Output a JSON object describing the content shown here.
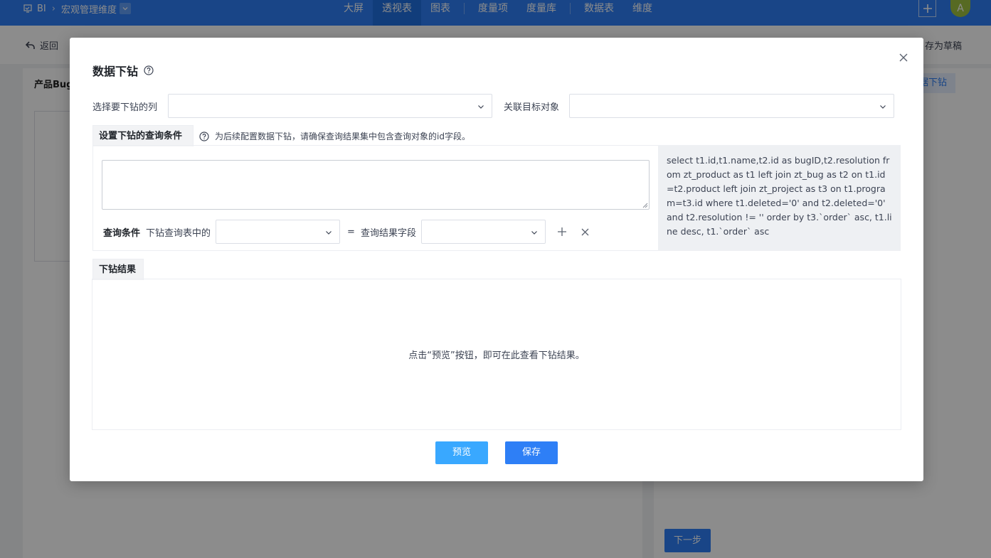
{
  "topbar": {
    "brand": "BI",
    "workspace": "宏观管理维度",
    "nav": [
      "大屏",
      "透视表",
      "图表",
      "度量项",
      "度量库",
      "数据表",
      "维度"
    ],
    "active_nav_index": 1,
    "avatar_letter": "A",
    "brand_color": "#2e7ff6"
  },
  "page": {
    "back_label": "返回",
    "draft_label": "存为草稿",
    "left_title": "产品Bug",
    "right_pill": "据下钻",
    "next_label": "下一步"
  },
  "modal": {
    "title": "数据下钻",
    "select_column_label": "选择要下钻的列",
    "select_column_value": "",
    "target_object_label": "关联目标对象",
    "target_object_value": "",
    "query_tab_label": "设置下钻的查询条件",
    "query_hint": "为后续配置数据下钻，请确保查询结果集中包含查询对象的id字段。",
    "query_sql_input": "",
    "condition_label": "查询条件",
    "drill_field_label": "下钻查询表中的",
    "drill_field_value": "",
    "equals": "=",
    "result_field_label": "查询结果字段",
    "result_field_value": "",
    "sql": "select t1.id,t1.name,t2.id as bugID,t2.resolution from zt_product as t1 left join zt_bug as t2 on t1.id=t2.product left join zt_project as t3 on t1.program=t3.id where t1.deleted='0' and t2.deleted='0' and t2.resolution != '' order by t3.`order` asc, t1.line desc, t1.`order` asc",
    "result_tab_label": "下钻结果",
    "result_empty": "点击“预览”按钮，即可在此查看下钻结果。",
    "preview_label": "预览",
    "save_label": "保存"
  }
}
